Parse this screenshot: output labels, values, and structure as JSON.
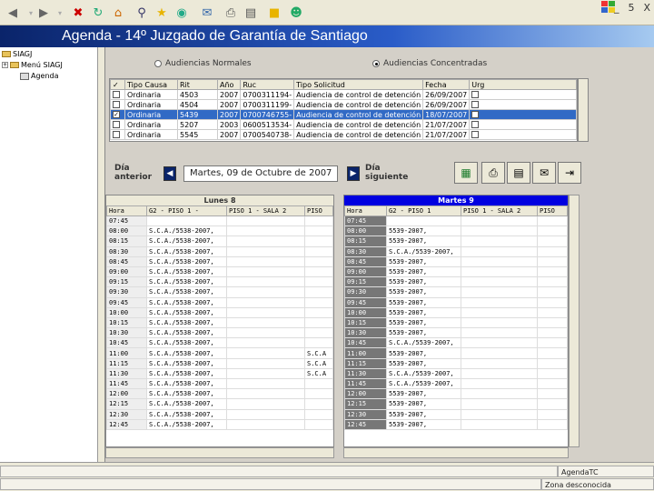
{
  "toolbar": {
    "icons": [
      "back-icon",
      "forward-icon",
      "stop-icon",
      "refresh-icon",
      "home-icon",
      "search-icon",
      "favorites-icon",
      "media-icon",
      "mail-icon",
      "print-icon",
      "edit-icon",
      "messenger-icon"
    ],
    "window_controls": [
      "_",
      "5",
      "X"
    ]
  },
  "app": {
    "title": "Agenda - 14º Juzgado de Garantía de Santiago"
  },
  "tree": {
    "items": [
      {
        "label": "SIAGJ",
        "toggle": "",
        "indent": 0
      },
      {
        "label": "Menú SIAGJ",
        "toggle": "+",
        "indent": 1
      },
      {
        "label": "Agenda",
        "toggle": "",
        "indent": 2
      }
    ]
  },
  "filters": {
    "option1": "Audiencias Normales",
    "option2": "Audiencias Concentradas",
    "selected": "option2"
  },
  "cases": {
    "columns": [
      "✓",
      "Tipo Causa",
      "Rit",
      "Año",
      "Ruc",
      "Tipo Solicitud",
      "Fecha",
      "Urg"
    ],
    "rows": [
      {
        "checked": false,
        "tipo": "Ordinaria",
        "rit": "4503",
        "anio": "2007",
        "ruc": "0700311194-",
        "solicitud": "Audiencia de control de detención",
        "fecha": "26/09/2007",
        "urg": false,
        "selected": false
      },
      {
        "checked": false,
        "tipo": "Ordinaria",
        "rit": "4504",
        "anio": "2007",
        "ruc": "0700311199-",
        "solicitud": "Audiencia de control de detención",
        "fecha": "26/09/2007",
        "urg": false,
        "selected": false
      },
      {
        "checked": true,
        "tipo": "Ordinaria",
        "rit": "5439",
        "anio": "2007",
        "ruc": "0700746755-",
        "solicitud": "Audiencia de control de detención",
        "fecha": "18/07/2007",
        "urg": false,
        "selected": true
      },
      {
        "checked": false,
        "tipo": "Ordinaria",
        "rit": "5207",
        "anio": "2003",
        "ruc": "0600513534-",
        "solicitud": "Audiencia de control de detención",
        "fecha": "21/07/2007",
        "urg": false,
        "selected": false
      },
      {
        "checked": false,
        "tipo": "Ordinaria",
        "rit": "5545",
        "anio": "2007",
        "ruc": "0700540738-",
        "solicitud": "Audiencia de control de detención",
        "fecha": "21/07/2007",
        "urg": false,
        "selected": false
      }
    ]
  },
  "datenav": {
    "prev_label_1": "Día",
    "prev_label_2": "anterior",
    "date_value": "Martes, 09 de Octubre de 2007",
    "next_label_1": "Día",
    "next_label_2": "siguiente"
  },
  "actions": {
    "icons": [
      "excel-icon",
      "print-preview-icon",
      "print-icon",
      "email-icon",
      "exit-icon"
    ]
  },
  "schedule_left": {
    "heading": "Lunes 8",
    "columns": [
      "Hora",
      "G2 - PISO 1 -",
      "PISO 1 - SALA 2",
      "PISO"
    ],
    "rows": [
      {
        "hora": "07:45",
        "c1": "",
        "c2": "",
        "c3": ""
      },
      {
        "hora": "08:00",
        "c1": "S.C.A./5538-2007,",
        "c2": "",
        "c3": ""
      },
      {
        "hora": "08:15",
        "c1": "S.C.A./5538-2007,",
        "c2": "",
        "c3": ""
      },
      {
        "hora": "08:30",
        "c1": "S.C.A./5538-2007,",
        "c2": "",
        "c3": ""
      },
      {
        "hora": "08:45",
        "c1": "S.C.A./5538-2007,",
        "c2": "",
        "c3": ""
      },
      {
        "hora": "09:00",
        "c1": "S.C.A./5538-2007,",
        "c2": "",
        "c3": ""
      },
      {
        "hora": "09:15",
        "c1": "S.C.A./5538-2007,",
        "c2": "",
        "c3": ""
      },
      {
        "hora": "09:30",
        "c1": "S.C.A./5538-2007,",
        "c2": "",
        "c3": ""
      },
      {
        "hora": "09:45",
        "c1": "S.C.A./5538-2007,",
        "c2": "",
        "c3": ""
      },
      {
        "hora": "10:00",
        "c1": "S.C.A./5538-2007,",
        "c2": "",
        "c3": ""
      },
      {
        "hora": "10:15",
        "c1": "S.C.A./5538-2007,",
        "c2": "",
        "c3": ""
      },
      {
        "hora": "10:30",
        "c1": "S.C.A./5538-2007,",
        "c2": "",
        "c3": ""
      },
      {
        "hora": "10:45",
        "c1": "S.C.A./5538-2007,",
        "c2": "",
        "c3": ""
      },
      {
        "hora": "11:00",
        "c1": "S.C.A./5538-2007,",
        "c2": "",
        "c3": "S.C.A"
      },
      {
        "hora": "11:15",
        "c1": "S.C.A./5538-2007,",
        "c2": "",
        "c3": "S.C.A"
      },
      {
        "hora": "11:30",
        "c1": "S.C.A./5538-2007,",
        "c2": "",
        "c3": "S.C.A"
      },
      {
        "hora": "11:45",
        "c1": "S.C.A./5538-2007,",
        "c2": "",
        "c3": ""
      },
      {
        "hora": "12:00",
        "c1": "S.C.A./5538-2007,",
        "c2": "",
        "c3": ""
      },
      {
        "hora": "12:15",
        "c1": "S.C.A./5538-2007,",
        "c2": "",
        "c3": ""
      },
      {
        "hora": "12:30",
        "c1": "S.C.A./5538-2007,",
        "c2": "",
        "c3": ""
      },
      {
        "hora": "12:45",
        "c1": "S.C.A./5538-2007,",
        "c2": "",
        "c3": ""
      }
    ]
  },
  "schedule_right": {
    "heading": "Martes 9",
    "columns": [
      "Hora",
      "G2 - PISO 1",
      "PISO 1 - SALA 2",
      "PISO"
    ],
    "rows": [
      {
        "hora": "07:45",
        "c1": "",
        "c2": "",
        "c3": ""
      },
      {
        "hora": "08:00",
        "c1": "5539-2007,",
        "c2": "",
        "c3": ""
      },
      {
        "hora": "08:15",
        "c1": "5539-2007,",
        "c2": "",
        "c3": ""
      },
      {
        "hora": "08:30",
        "c1": "S.C.A./5539-2007,",
        "c2": "",
        "c3": ""
      },
      {
        "hora": "08:45",
        "c1": "5539-2007,",
        "c2": "",
        "c3": ""
      },
      {
        "hora": "09:00",
        "c1": "5539-2007,",
        "c2": "",
        "c3": ""
      },
      {
        "hora": "09:15",
        "c1": "5539-2007,",
        "c2": "",
        "c3": ""
      },
      {
        "hora": "09:30",
        "c1": "5539-2007,",
        "c2": "",
        "c3": ""
      },
      {
        "hora": "09:45",
        "c1": "5539-2007,",
        "c2": "",
        "c3": ""
      },
      {
        "hora": "10:00",
        "c1": "5539-2007,",
        "c2": "",
        "c3": ""
      },
      {
        "hora": "10:15",
        "c1": "5539-2007,",
        "c2": "",
        "c3": ""
      },
      {
        "hora": "10:30",
        "c1": "5539-2007,",
        "c2": "",
        "c3": ""
      },
      {
        "hora": "10:45",
        "c1": "S.C.A./5539-2007,",
        "c2": "",
        "c3": ""
      },
      {
        "hora": "11:00",
        "c1": "5539-2007,",
        "c2": "",
        "c3": ""
      },
      {
        "hora": "11:15",
        "c1": "5539-2007,",
        "c2": "",
        "c3": ""
      },
      {
        "hora": "11:30",
        "c1": "S.C.A./5539-2007,",
        "c2": "",
        "c3": ""
      },
      {
        "hora": "11:45",
        "c1": "S.C.A./5539-2007,",
        "c2": "",
        "c3": ""
      },
      {
        "hora": "12:00",
        "c1": "5539-2007,",
        "c2": "",
        "c3": ""
      },
      {
        "hora": "12:15",
        "c1": "5539-2007,",
        "c2": "",
        "c3": ""
      },
      {
        "hora": "12:30",
        "c1": "5539-2007,",
        "c2": "",
        "c3": ""
      },
      {
        "hora": "12:45",
        "c1": "5539-2007,",
        "c2": "",
        "c3": ""
      }
    ]
  },
  "statusbar": {
    "app_name": "AgendaTC",
    "connection": "Zona desconocida"
  }
}
